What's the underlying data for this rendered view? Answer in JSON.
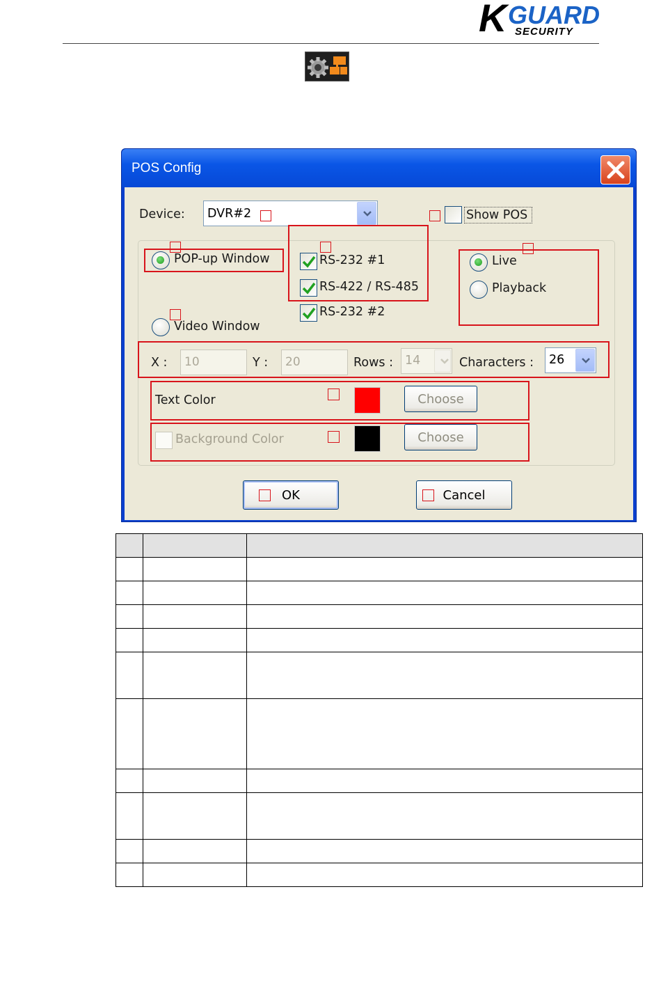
{
  "logo": {
    "brand_k": "K",
    "brand_guard": "GUARD",
    "brand_sub": "SECURITY"
  },
  "icons": {
    "toolbar": "pos-config-icon",
    "close": "close-icon",
    "dropdown": "chevron-down-icon",
    "check": "check-icon"
  },
  "dialog": {
    "title": "POS Config",
    "device": {
      "label": "Device:",
      "value": "DVR#2"
    },
    "show_pos": {
      "label": "Show POS",
      "checked": false
    },
    "display_mode": {
      "popup": {
        "label": "POP-up Window",
        "selected": true
      },
      "video": {
        "label": "Video Window",
        "selected": false
      }
    },
    "ports": [
      {
        "label": "RS-232 #1",
        "checked": true
      },
      {
        "label": "RS-422 / RS-485",
        "checked": true
      },
      {
        "label": "RS-232 #2",
        "checked": true
      }
    ],
    "mode": {
      "live": {
        "label": "Live",
        "selected": true
      },
      "playback": {
        "label": "Playback",
        "selected": false
      }
    },
    "position": {
      "x_label": "X :",
      "x_value": "10",
      "y_label": "Y :",
      "y_value": "20",
      "rows_label": "Rows :",
      "rows_value": "14",
      "chars_label": "Characters :",
      "chars_value": "26"
    },
    "text_color": {
      "label": "Text Color",
      "color": "#ff0000",
      "button": "Choose"
    },
    "background_color": {
      "label": "Background Color",
      "color": "#000000",
      "button": "Choose",
      "enabled": false
    },
    "ok_label": "OK",
    "cancel_label": "Cancel"
  },
  "colors": {
    "annotation": "#d8141b",
    "title_bar": "#0a56e6",
    "dialog_face": "#ece9d8"
  },
  "table": {
    "row_count": 10,
    "columns": 3
  }
}
